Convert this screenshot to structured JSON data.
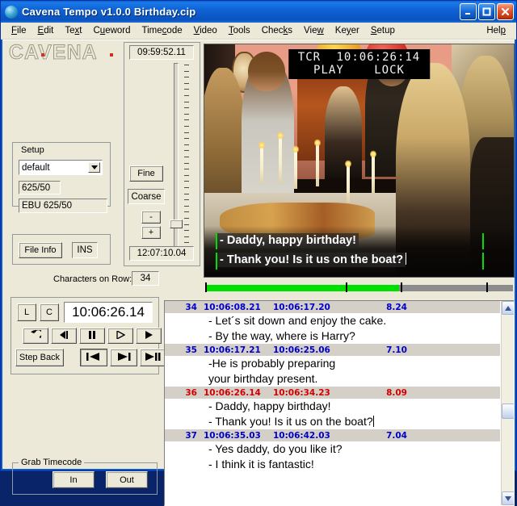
{
  "window": {
    "title": "Cavena Tempo v1.0.0   Birthday.cip",
    "minimize": "_",
    "maximize": "□",
    "close": "✕"
  },
  "menu": {
    "items": [
      {
        "label": "File",
        "mnemonic": "F"
      },
      {
        "label": "Edit",
        "mnemonic": "E"
      },
      {
        "label": "Text",
        "mnemonic": "x"
      },
      {
        "label": "Cueword",
        "mnemonic": "u"
      },
      {
        "label": "Timecode",
        "mnemonic": "c"
      },
      {
        "label": "Video",
        "mnemonic": "V"
      },
      {
        "label": "Tools",
        "mnemonic": "T"
      },
      {
        "label": "Checks",
        "mnemonic": "k"
      },
      {
        "label": "View",
        "mnemonic": "w"
      },
      {
        "label": "Keyer",
        "mnemonic": "y"
      },
      {
        "label": "Setup",
        "mnemonic": "S"
      }
    ],
    "help": "Help"
  },
  "logo": {
    "text": "CAVENA"
  },
  "setup_panel": {
    "title": "Setup",
    "profile": "default",
    "standard": "625/50",
    "format": "EBU 625/50"
  },
  "file_panel": {
    "file_info": "File Info",
    "insert_mode": "INS"
  },
  "characters_on_row": {
    "label": "Characters on Row:",
    "value": "34"
  },
  "timecode_panel": {
    "start": "09:59:52.11",
    "end": "12:07:10.04",
    "fine": "Fine",
    "coarse": "Coarse",
    "minus": "-",
    "plus": "+",
    "slider_percent": 88
  },
  "video": {
    "tcr_label": "TCR",
    "tcr_value": "10:06:26:14",
    "status_play": "PLAY",
    "status_lock": "LOCK",
    "subtitle_line1": "- Daddy, happy birthday!",
    "subtitle_line2": "- Thank you! Is it us on the boat?"
  },
  "progress": {
    "percent": 63,
    "fill_color": "#00e000",
    "track_color": "#8c8c8c"
  },
  "transport": {
    "left_button": "L",
    "center_button": "C",
    "timecode": "10:06:26.14",
    "step_back": "Step Back",
    "buttons": [
      {
        "name": "loop-rewind-icon"
      },
      {
        "name": "step-back-frame-icon"
      },
      {
        "name": "pause-icon"
      },
      {
        "name": "play-outline-icon"
      },
      {
        "name": "play-icon"
      }
    ],
    "jump_buttons": [
      {
        "name": "jump-to-start-icon"
      },
      {
        "name": "jump-forward-icon"
      },
      {
        "name": "jump-to-end-icon"
      }
    ]
  },
  "grab_timecode": {
    "title": "Grab Timecode",
    "in": "In",
    "out": "Out"
  },
  "subtitle_list": {
    "scroll_percent": 55,
    "rows": [
      {
        "number": "34",
        "in": "10:06:08.21",
        "out": "10:06:17.20",
        "duration": "8.24",
        "current": false,
        "lines": [
          "- Let´s sit down and enjoy the cake.",
          "- By the way, where is Harry?"
        ]
      },
      {
        "number": "35",
        "in": "10:06:17.21",
        "out": "10:06:25.06",
        "duration": "7.10",
        "current": false,
        "lines": [
          "-He is probably preparing",
          "your birthday present."
        ]
      },
      {
        "number": "36",
        "in": "10:06:26.14",
        "out": "10:06:34.23",
        "duration": "8.09",
        "current": true,
        "lines": [
          "- Daddy, happy birthday!",
          "- Thank you! Is it us on the boat?"
        ]
      },
      {
        "number": "37",
        "in": "10:06:35.03",
        "out": "10:06:42.03",
        "duration": "7.04",
        "current": false,
        "lines": [
          "- Yes daddy, do you like it?",
          "- I think it is fantastic!"
        ]
      }
    ]
  },
  "colors": {
    "face": "#ece9d8",
    "title_blue": "#0b57c8",
    "row_blue": "#0000cd",
    "row_red": "#d40000",
    "green": "#00e000"
  }
}
